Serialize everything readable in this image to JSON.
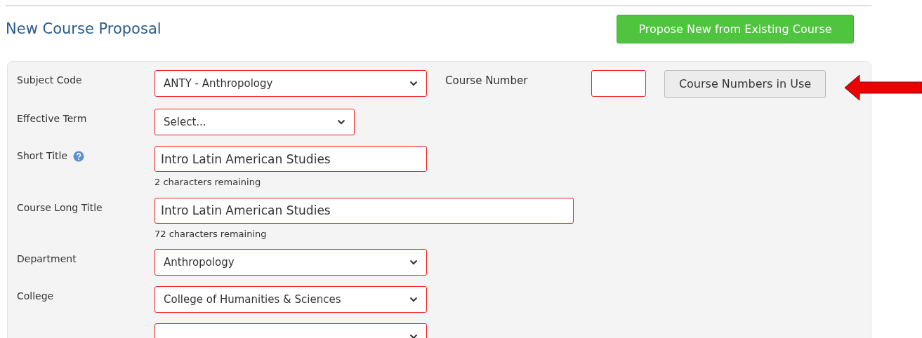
{
  "page_title": "New Course Proposal",
  "propose_button": "Propose New from Existing Course",
  "course_number": {
    "label": "Course Number",
    "button": "Course Numbers in Use"
  },
  "rows": [
    {
      "label": "Subject Code",
      "kind": "select",
      "value": "ANTY - Anthropology",
      "help": false
    },
    {
      "label": "Effective Term",
      "kind": "select",
      "value": "Select...",
      "help": false
    },
    {
      "label": "Short Title",
      "kind": "text",
      "value": "Intro Latin American Studies",
      "help": true,
      "helper": "2 characters remaining"
    },
    {
      "label": "Course Long Title",
      "kind": "text",
      "value": "Intro Latin American Studies",
      "help": false,
      "helper": "72 characters remaining"
    },
    {
      "label": "Department",
      "kind": "select",
      "value": "Anthropology",
      "help": false
    },
    {
      "label": "College",
      "kind": "select",
      "value": "College of Humanities & Sciences",
      "help": false
    },
    {
      "kind": "select",
      "help": false
    }
  ]
}
